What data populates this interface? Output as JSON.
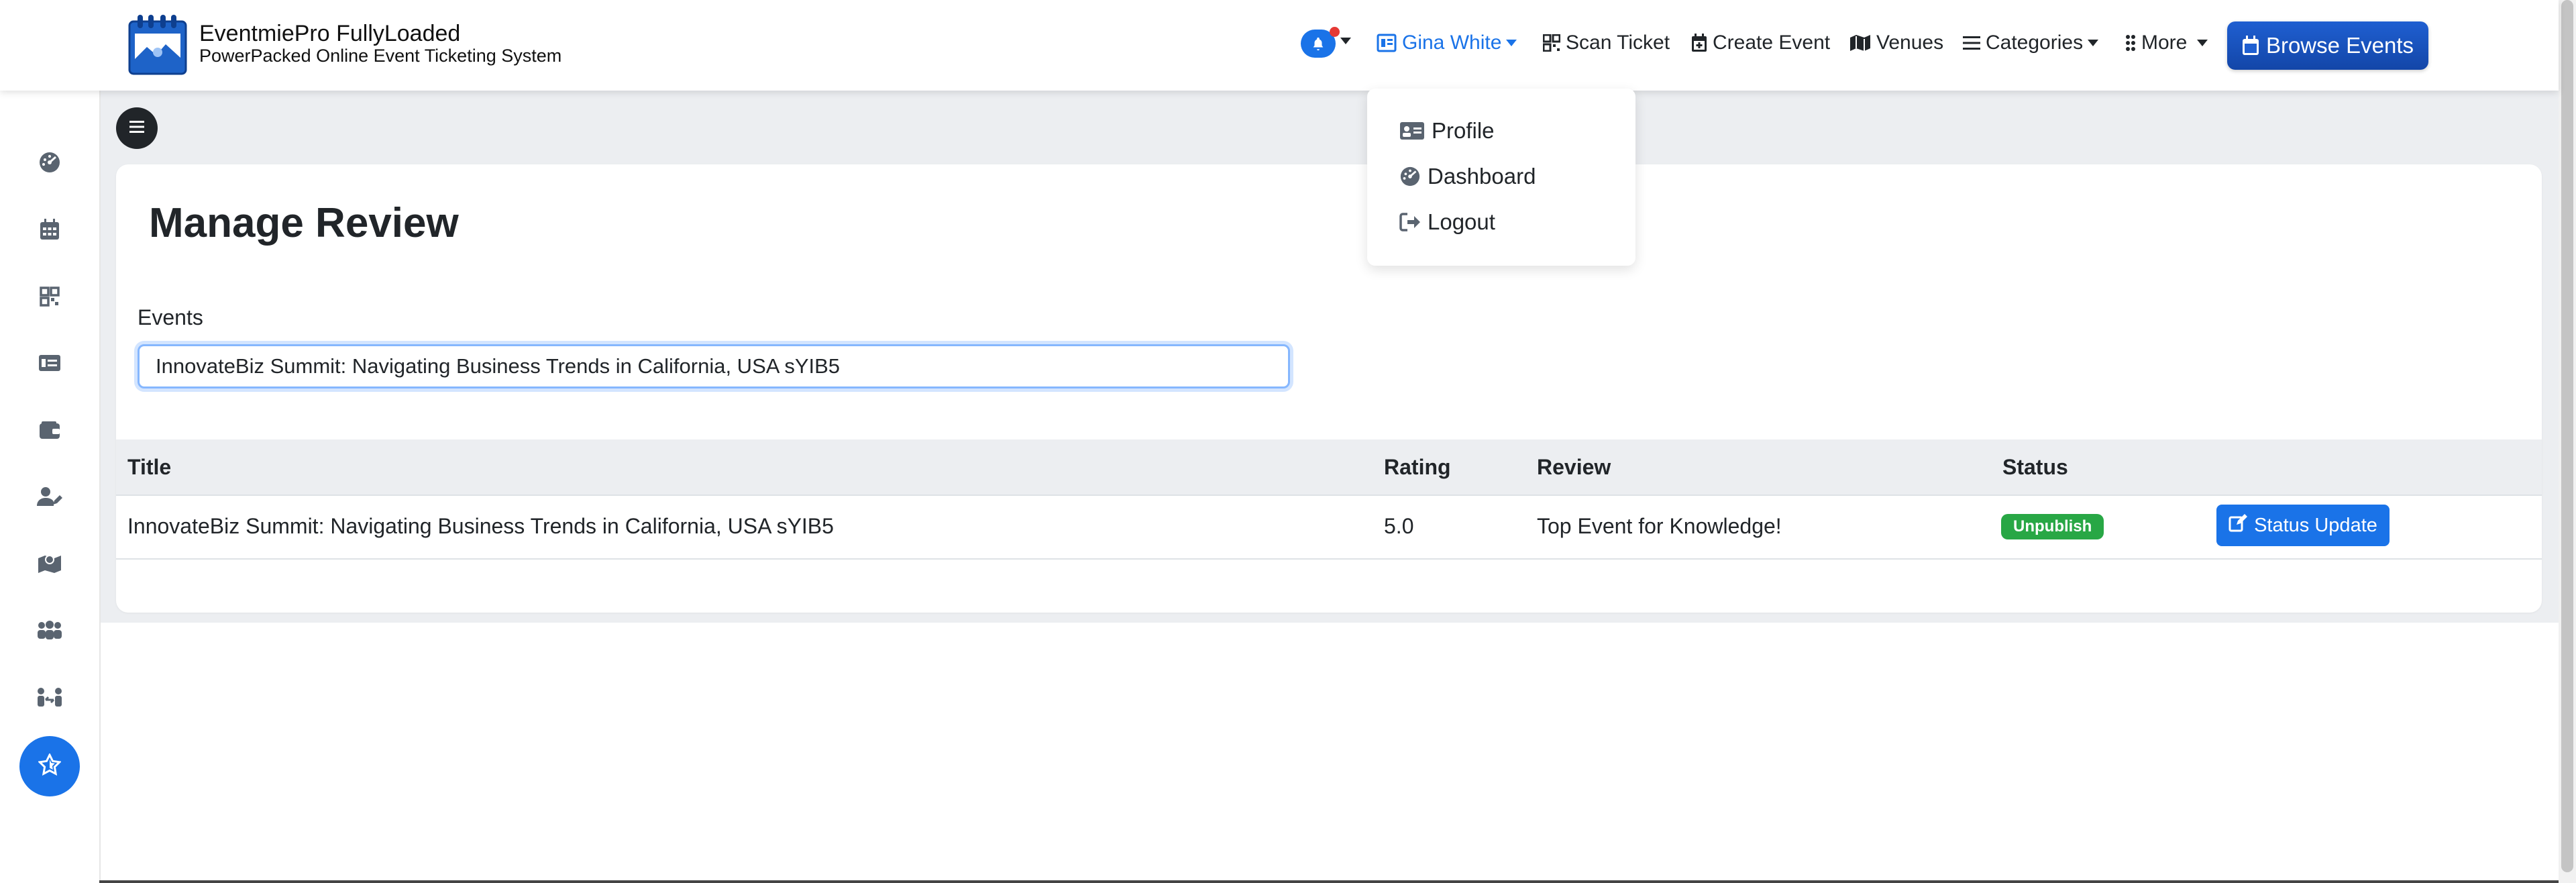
{
  "brand": {
    "name": "EventmiePro FullyLoaded",
    "tagline": "PowerPacked Online Event Ticketing System"
  },
  "nav": {
    "user_name": "Gina White",
    "scan_ticket": "Scan Ticket",
    "create_event": "Create Event",
    "venues": "Venues",
    "categories": "Categories",
    "more": "More",
    "browse_events": "Browse Events"
  },
  "user_menu": {
    "items": [
      {
        "label": "Profile",
        "icon": "id-card-icon"
      },
      {
        "label": "Dashboard",
        "icon": "dashboard-icon"
      },
      {
        "label": "Logout",
        "icon": "logout-icon"
      }
    ]
  },
  "sidebar": {
    "icons": [
      "dashboard-icon",
      "calendar-icon",
      "qrcode-icon",
      "ticket-card-icon",
      "wallet-icon",
      "user-edit-icon",
      "map-icon",
      "users-icon",
      "people-arrows-icon",
      "star-icon"
    ],
    "active": "star-icon"
  },
  "page": {
    "title": "Manage Review",
    "events_label": "Events",
    "events_value": "InnovateBiz Summit: Navigating Business Trends in California, USA sYIB5"
  },
  "table": {
    "headers": {
      "title": "Title",
      "rating": "Rating",
      "review": "Review",
      "status": "Status"
    },
    "rows": [
      {
        "title": "InnovateBiz Summit: Navigating Business Trends in California, USA sYIB5",
        "rating": "5.0",
        "review": "Top Event for Knowledge!",
        "status": "Unpublish",
        "action": "Status Update"
      }
    ]
  },
  "colors": {
    "primary": "#1a73e8",
    "badge_green": "#28a745",
    "notification_dot": "#e53935"
  }
}
